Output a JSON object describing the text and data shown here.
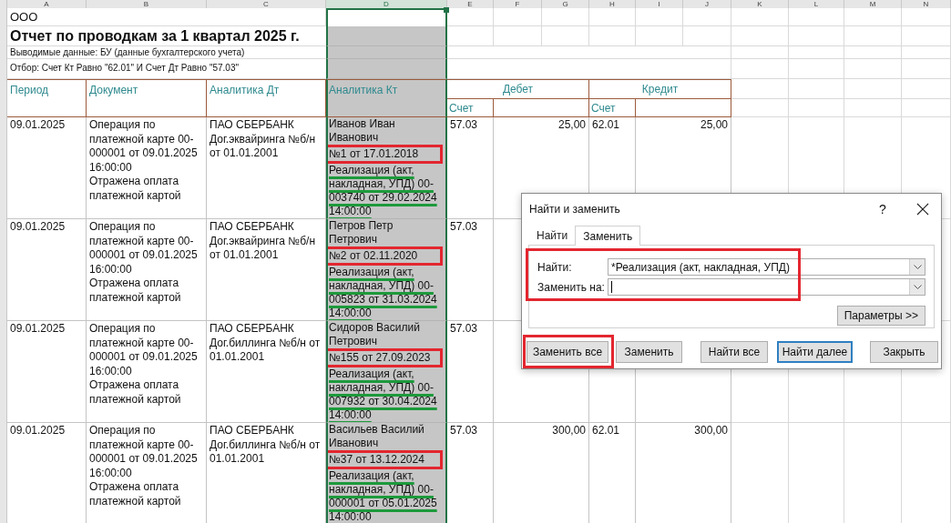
{
  "sheet": {
    "column_letters": [
      "A",
      "B",
      "C",
      "D",
      "E",
      "F",
      "G",
      "H",
      "I",
      "J",
      "K",
      "L",
      "M",
      "N"
    ],
    "company": "ООО",
    "title": "Отчет по проводкам за 1 квартал 2025 г.",
    "notes": [
      "Выводимые данные: БУ (данные бухгалтерского учета)",
      "Отбор: Счет Кт Равно \"62.01\" И Счет Дт Равно \"57.03\""
    ],
    "columns": {
      "period": "Период",
      "document": "Документ",
      "analytics_dt": "Аналитика Дт",
      "analytics_kt": "Аналитика Кт",
      "debit": "Дебет",
      "credit": "Кредит",
      "debit_account": "Счет",
      "credit_account": "Счет"
    },
    "rows": [
      {
        "period": "09.01.2025",
        "document": [
          "Операция по платежной карте 00-000001 от 09.01.2025 16:00:00",
          "Отражена оплата платежной картой"
        ],
        "analytics_dt": [
          "ПАО СБЕРБАНК",
          "Дог.эквайринга №б/н от 01.01.2001"
        ],
        "analytics_kt": {
          "name": "Иванов Иван Иванович",
          "contract": "№1 от 17.01.2018",
          "contract_highlighted": true,
          "document": "Реализация (акт, накладная, УПД) 00-003740 от 29.02.2024 14:00:00",
          "document_underlined": true
        },
        "debit_account": "57.03",
        "debit_amount": "25,00",
        "credit_account": "62.01",
        "credit_amount": "25,00"
      },
      {
        "period": "09.01.2025",
        "document": [
          "Операция по платежной карте 00-000001 от 09.01.2025 16:00:00",
          "Отражена оплата платежной картой"
        ],
        "analytics_dt": [
          "ПАО СБЕРБАНК",
          "Дог.эквайринга №б/н от 01.01.2001"
        ],
        "analytics_kt": {
          "name": "Петров Петр Петрович",
          "contract": "№2 от 02.11.2020",
          "contract_highlighted": true,
          "document": "Реализация (акт, накладная, УПД) 00-005823 от 31.03.2024 14:00:00",
          "document_underlined": true
        },
        "debit_account": "57.03"
      },
      {
        "period": "09.01.2025",
        "document": [
          "Операция по платежной карте 00-000001 от 09.01.2025 16:00:00",
          "Отражена оплата платежной картой"
        ],
        "analytics_dt": [
          "ПАО СБЕРБАНК",
          "Дог.биллинга №б/н от 01.01.2001"
        ],
        "analytics_kt": {
          "name": "Сидоров Василий Петрович",
          "contract": "№155 от 27.09.2023",
          "contract_highlighted": true,
          "document": "Реализация (акт, накладная, УПД) 00-007932 от 30.04.2024 14:00:00",
          "document_underlined": true
        },
        "debit_account": "57.03"
      },
      {
        "period": "09.01.2025",
        "document": [
          "Операция по платежной карте 00-000001 от 09.01.2025 16:00:00",
          "Отражена оплата платежной картой"
        ],
        "analytics_dt": [
          "ПАО СБЕРБАНК",
          "Дог.биллинга №б/н от 01.01.2001"
        ],
        "analytics_kt": {
          "name": "Васильев Василий Иванович",
          "contract": "№37 от 13.12.2024",
          "contract_highlighted": true,
          "document": "Реализация (акт, накладная, УПД) 00-000001 от 05.01.2025 14:00:00",
          "document_underlined": true
        },
        "debit_account": "57.03",
        "debit_amount": "300,00",
        "credit_account": "62.01",
        "credit_amount": "300,00"
      }
    ]
  },
  "dialog": {
    "title": "Найти и заменить",
    "help": "?",
    "tabs": [
      {
        "label": "Найти",
        "selected": false
      },
      {
        "label": "Заменить",
        "selected": true
      }
    ],
    "fields_highlighted": true,
    "find": {
      "label": "Найти:",
      "value": "*Реализация (акт, накладная, УПД)"
    },
    "replace": {
      "label": "Заменить на:",
      "focused": true
    },
    "options_button": "Параметры >>",
    "buttons": [
      {
        "label": "Заменить все",
        "highlighted": true,
        "default": false
      },
      {
        "label": "Заменить",
        "highlighted": false,
        "default": false
      },
      {
        "label": "Найти все",
        "highlighted": false,
        "default": false
      },
      {
        "label": "Найти далее",
        "highlighted": false,
        "default": true
      },
      {
        "label": "Закрыть",
        "highlighted": false,
        "default": false
      }
    ]
  }
}
